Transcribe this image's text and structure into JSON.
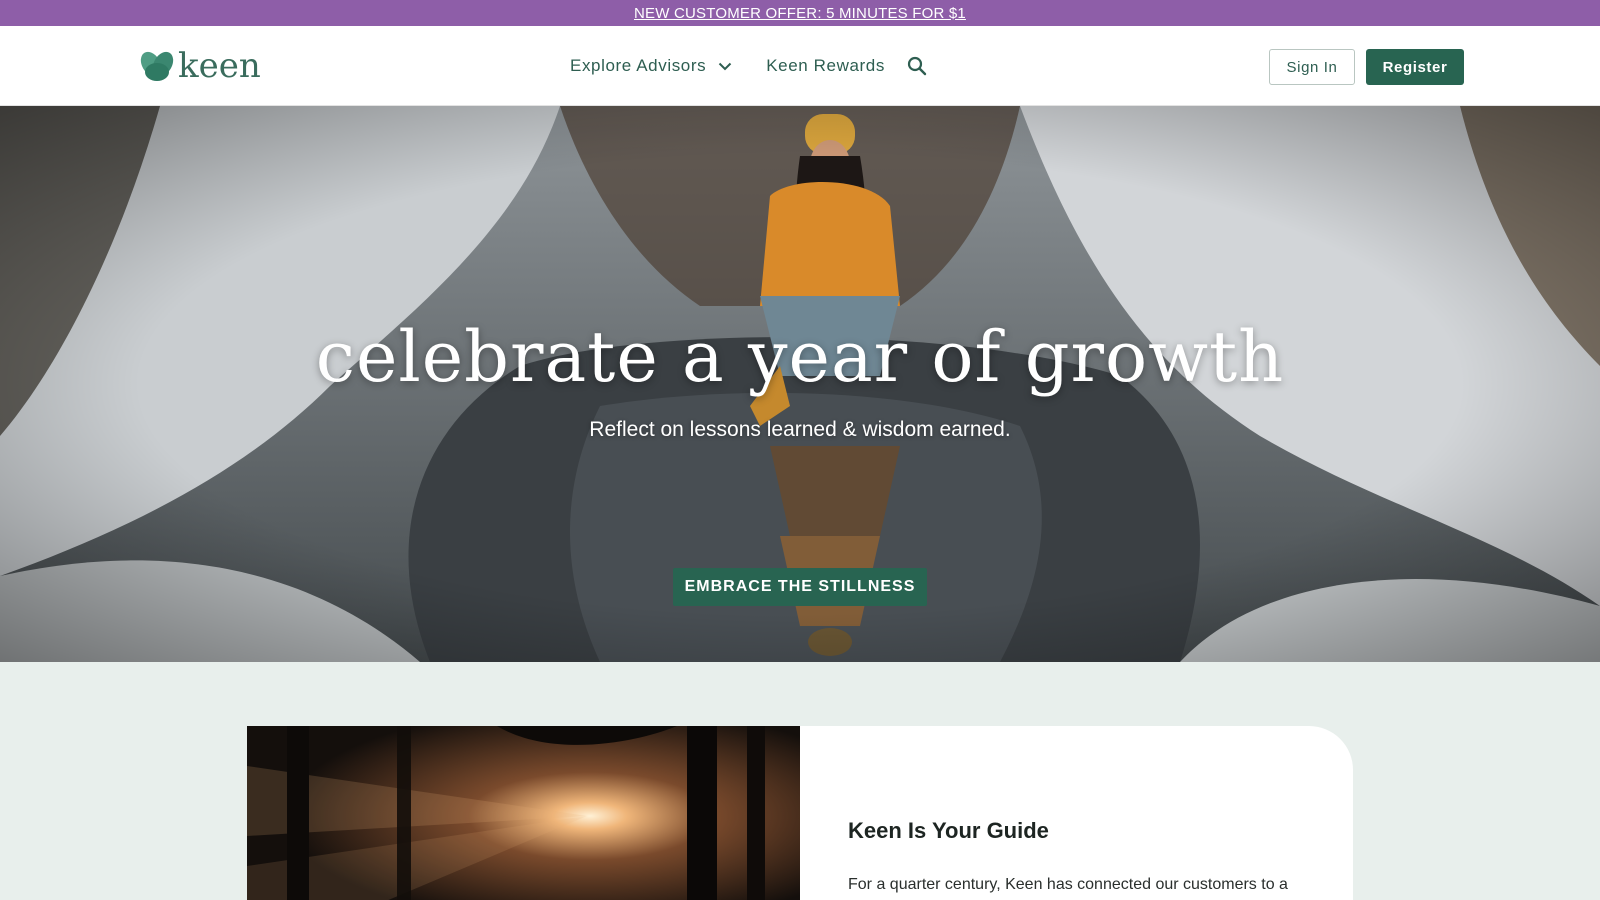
{
  "promo": {
    "text": "NEW CUSTOMER OFFER: 5 MINUTES FOR $1"
  },
  "header": {
    "logo_text": "keen",
    "nav": [
      {
        "label": "Explore Advisors",
        "icon": "chevron-down-icon"
      },
      {
        "label": "Keen Rewards"
      }
    ],
    "search_icon": "search-icon",
    "sign_in": "Sign In",
    "register": "Register"
  },
  "hero": {
    "title": "celebrate a year of growth",
    "subtitle": "Reflect on lessons learned & wisdom earned.",
    "cta": "EMBRACE THE STILLNESS"
  },
  "guide": {
    "title": "Keen Is Your Guide",
    "body": "For a quarter century, Keen has connected our customers to a"
  },
  "colors": {
    "promo_bg": "#8e5ea8",
    "brand_green": "#286451",
    "nav_text": "#2e5e51",
    "page_bg": "#e8efec"
  }
}
